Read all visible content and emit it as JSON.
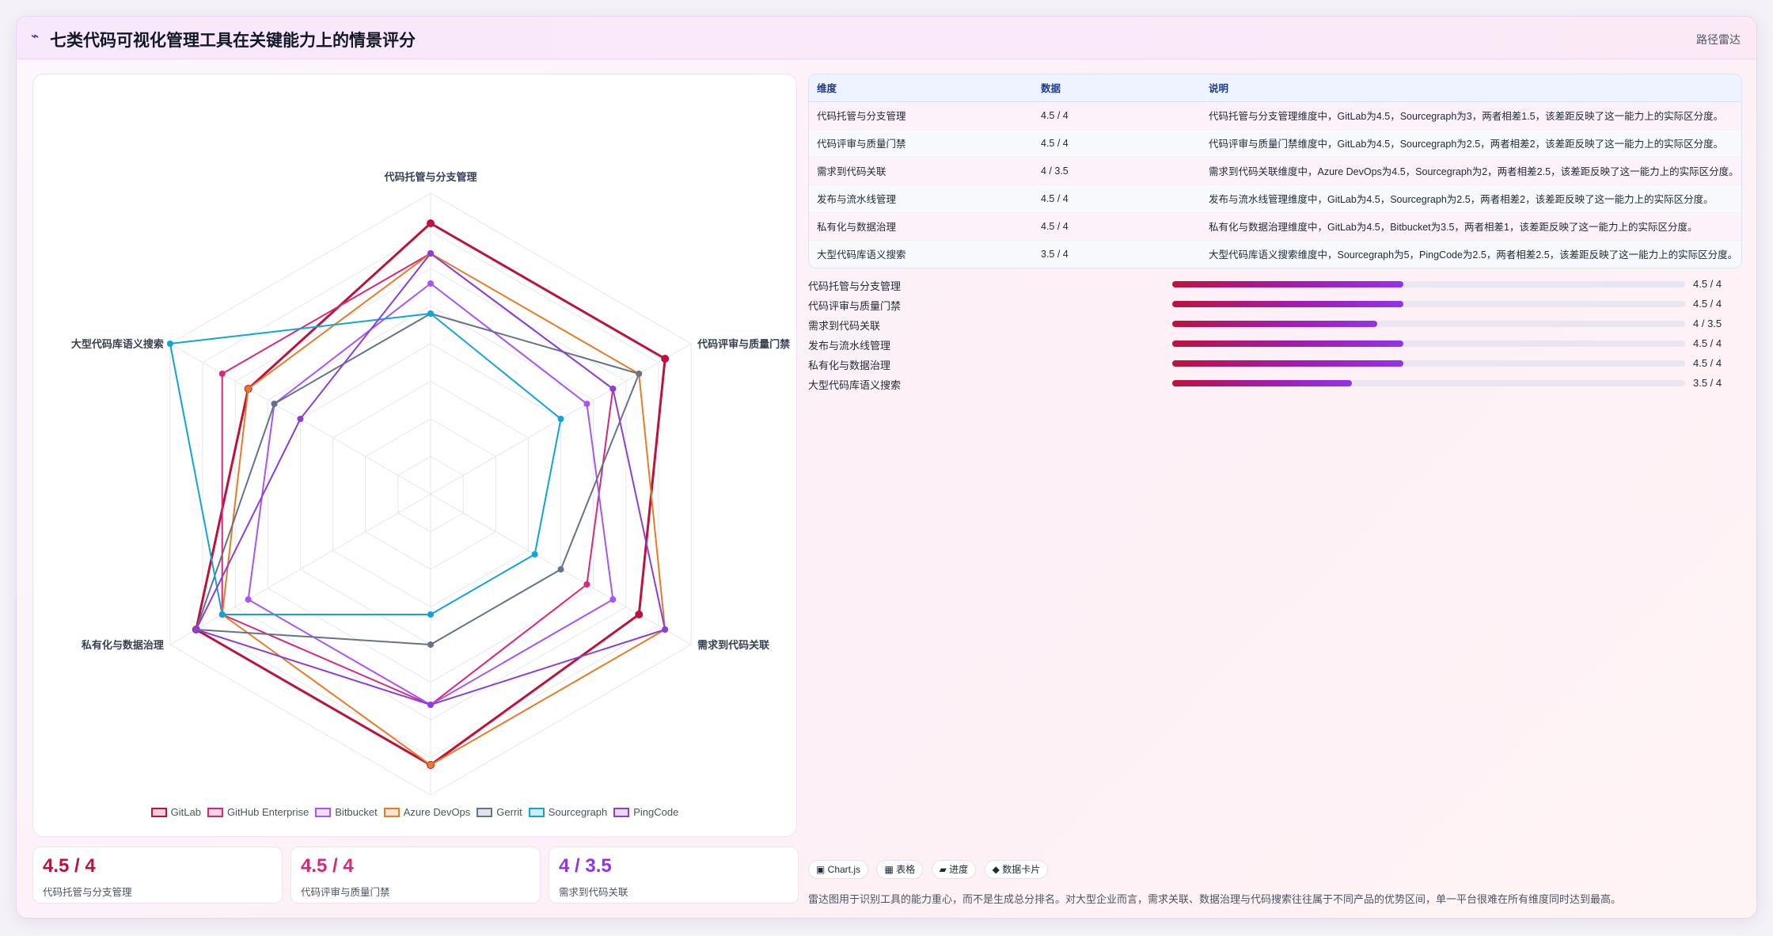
{
  "header": {
    "logo_glyph": "⌁",
    "title": "七类代码可视化管理工具在关键能力上的情景评分",
    "route_label": "路径雷达"
  },
  "colors": {
    "GitLab": "#be123c",
    "GitHub Enterprise": "#db2777",
    "Bitbucket": "#a855f7",
    "Azure DevOps": "#ea7a24",
    "Gerrit": "#64748b",
    "Sourcegraph": "#0ea5d9",
    "PingCode": "#8b3fd9"
  },
  "chart_data": {
    "type": "radar",
    "categories": [
      "代码托管与分支管理",
      "代码评审与质量门禁",
      "需求到代码关联",
      "发布与流水线管理",
      "私有化与数据治理",
      "大型代码库语义搜索"
    ],
    "range": [
      0,
      5
    ],
    "grid": true,
    "legend_position": "bottom",
    "series": [
      {
        "name": "GitLab",
        "values": [
          4.5,
          4.5,
          4,
          4.5,
          4.5,
          3.5
        ]
      },
      {
        "name": "GitHub Enterprise",
        "values": [
          4,
          3.5,
          3,
          3.5,
          4,
          4
        ]
      },
      {
        "name": "Bitbucket",
        "values": [
          3.5,
          3,
          3.5,
          3.5,
          3.5,
          3
        ]
      },
      {
        "name": "Azure DevOps",
        "values": [
          4,
          4,
          4.5,
          4.5,
          4,
          3.5
        ]
      },
      {
        "name": "Gerrit",
        "values": [
          3,
          4,
          2.5,
          2.5,
          4.5,
          3
        ]
      },
      {
        "name": "Sourcegraph",
        "values": [
          3,
          2.5,
          2,
          2,
          4,
          5
        ]
      },
      {
        "name": "PingCode",
        "values": [
          4,
          3.5,
          4.5,
          3.5,
          4.5,
          2.5
        ]
      }
    ]
  },
  "table": {
    "headers": [
      "维度",
      "数据",
      "说明"
    ],
    "rows": [
      [
        "代码托管与分支管理",
        "4.5 / 4",
        "代码托管与分支管理维度中，GitLab为4.5，Sourcegraph为3，两者相差1.5，该差距反映了这一能力上的实际区分度。"
      ],
      [
        "代码评审与质量门禁",
        "4.5 / 4",
        "代码评审与质量门禁维度中，GitLab为4.5，Sourcegraph为2.5，两者相差2，该差距反映了这一能力上的实际区分度。"
      ],
      [
        "需求到代码关联",
        "4 / 3.5",
        "需求到代码关联维度中，Azure DevOps为4.5，Sourcegraph为2，两者相差2.5，该差距反映了这一能力上的实际区分度。"
      ],
      [
        "发布与流水线管理",
        "4.5 / 4",
        "发布与流水线管理维度中，GitLab为4.5，Sourcegraph为2.5，两者相差2，该差距反映了这一能力上的实际区分度。"
      ],
      [
        "私有化与数据治理",
        "4.5 / 4",
        "私有化与数据治理维度中，GitLab为4.5，Bitbucket为3.5，两者相差1，该差距反映了这一能力上的实际区分度。"
      ],
      [
        "大型代码库语义搜索",
        "3.5 / 4",
        "大型代码库语义搜索维度中，Sourcegraph为5，PingCode为2.5，两者相差2.5，该差距反映了这一能力上的实际区分度。"
      ]
    ]
  },
  "bars": [
    {
      "label": "代码托管与分支管理",
      "value": "4.5 / 4",
      "fraction": 0.45
    },
    {
      "label": "代码评审与质量门禁",
      "value": "4.5 / 4",
      "fraction": 0.45
    },
    {
      "label": "需求到代码关联",
      "value": "4 / 3.5",
      "fraction": 0.4
    },
    {
      "label": "发布与流水线管理",
      "value": "4.5 / 4",
      "fraction": 0.45
    },
    {
      "label": "私有化与数据治理",
      "value": "4.5 / 4",
      "fraction": 0.45
    },
    {
      "label": "大型代码库语义搜索",
      "value": "3.5 / 4",
      "fraction": 0.35
    }
  ],
  "kpis": [
    {
      "value": "4.5 / 4",
      "label": "代码托管与分支管理",
      "color": "#be123c"
    },
    {
      "value": "4.5 / 4",
      "label": "代码评审与质量门禁",
      "color": "#db2777"
    },
    {
      "value": "4 / 3.5",
      "label": "需求到代码关联",
      "color": "#9333ea"
    }
  ],
  "chips": [
    "▣ Chart.js",
    "▦ 表格",
    "▰ 进度",
    "◆ 数据卡片"
  ],
  "note": "雷达图用于识别工具的能力重心，而不是生成总分排名。对大型企业而言，需求关联、数据治理与代码搜索往往属于不同产品的优势区间，单一平台很难在所有维度同时达到最高。"
}
